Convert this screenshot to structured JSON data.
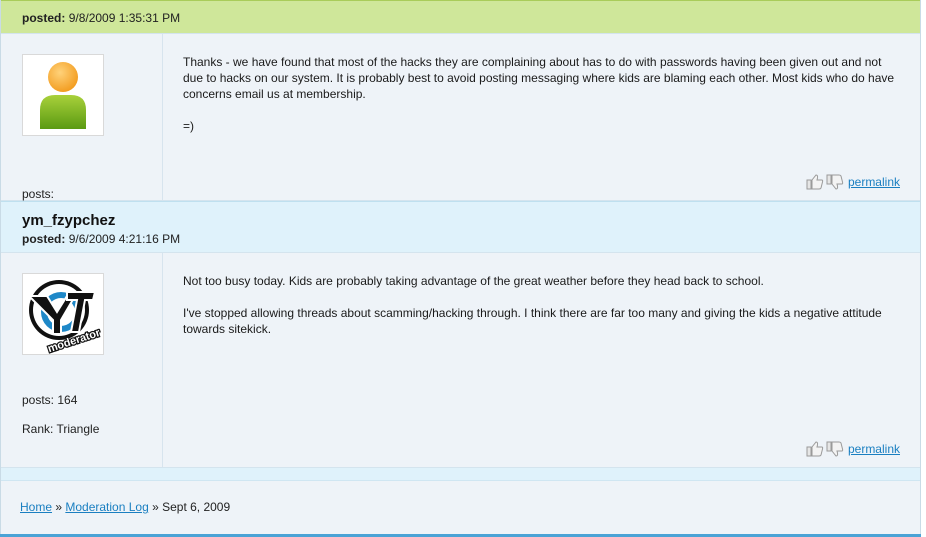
{
  "posts": [
    {
      "username": "",
      "posted_label": "posted:",
      "posted_value": "9/8/2009 1:35:31 PM",
      "avatar": "default-user-icon",
      "posts_label": "posts:",
      "posts_count": "",
      "rank": "",
      "paragraphs": [
        "Thanks - we have found that most of the hacks they are complaining about has to do with passwords having been given out and not due to hacks on our system. It is probably best to avoid posting messaging where kids are blaming each other. Most kids who do have concerns email us at membership.",
        "=)"
      ],
      "permalink": "permalink"
    },
    {
      "username": "ym_fzypchez",
      "posted_label": "posted:",
      "posted_value": "9/6/2009 4:21:16 PM",
      "avatar": "ytv-moderator-logo",
      "posts_label": "posts: 164",
      "rank": "Rank: Triangle",
      "paragraphs": [
        "Not too busy today. Kids are probably taking advantage of the great weather before they head back to school.",
        "I've stopped allowing threads about scamming/hacking through. I think there are far too many and giving the kids a negative attitude towards sitekick."
      ],
      "permalink": "permalink"
    }
  ],
  "breadcrumb": {
    "home": "Home",
    "sep1": " » ",
    "log": "Moderation Log",
    "sep2": " » ",
    "current": "Sept 6, 2009"
  },
  "colors": {
    "header_green": "#cfe79a",
    "header_blue": "#dff2fb",
    "link": "#1a7fc1",
    "panel": "#eef3f8"
  },
  "logo_text": "moderator"
}
